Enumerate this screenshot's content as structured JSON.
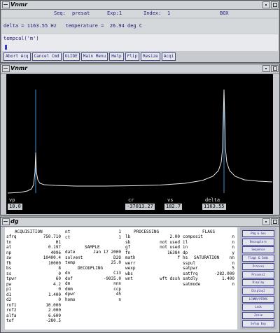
{
  "cmd_window": {
    "title": "Vnmr",
    "seq_label": "Seq:",
    "seq_value": "presat",
    "exp_label": "Exp:1",
    "index_label": "Index:",
    "index_value": "1",
    "box_label": "BOX",
    "status_line": "delta = 1163.55 Hz   temperature =  26.94 deg C",
    "command_line": "tempcal('m')",
    "buttons": [
      "Abort Acq",
      "Cancel Cmd",
      "GLIDE",
      "Main Menu",
      "Help",
      "Flip",
      "Resize",
      "Acqi"
    ]
  },
  "spectrum_window": {
    "title": "Vnmr",
    "readouts": [
      {
        "label": "vp",
        "value": "10.0"
      },
      {
        "label": "cr",
        "value": "-37013.27"
      },
      {
        "label": "vs",
        "value": "182.7"
      },
      {
        "label": "delta",
        "value": "1163.55"
      }
    ],
    "trace_color": "#e8e8e8",
    "cursor_color": "#3b8fd8"
  },
  "dg_window": {
    "title": "dg",
    "col1": {
      "header": "ACQUISITION",
      "rows": [
        [
          "sfrq",
          "750.710"
        ],
        [
          "tn",
          "H1"
        ],
        [
          "at",
          "0.197"
        ],
        [
          "np",
          "4096"
        ],
        [
          "sw",
          "10400.4"
        ],
        [
          "fb",
          "10000"
        ],
        [
          "bs",
          "8"
        ],
        [
          "ss",
          "0"
        ],
        [
          "tpwr",
          "60"
        ],
        [
          "pw",
          "4.2"
        ],
        [
          "p1",
          "0"
        ],
        [
          "d1",
          "1.400"
        ],
        [
          "d2",
          "0"
        ],
        [
          "rof1",
          "10.000"
        ],
        [
          "rof2",
          "2.000"
        ],
        [
          "alfa",
          "6.600"
        ],
        [
          "tof",
          "-280.5"
        ]
      ]
    },
    "col2": {
      "rows": [
        [
          "nt",
          "1"
        ],
        [
          "ct",
          "1"
        ]
      ],
      "sample_header": "SAMPLE",
      "sample_rows": [
        [
          "date",
          "Jan 17 2000"
        ],
        [
          "solvent",
          "D2O"
        ],
        [
          "temp",
          "25.0"
        ]
      ],
      "decoupling_header": "DECOUPLING",
      "decoupling_rows": [
        [
          "dn",
          "C13"
        ],
        [
          "dof",
          "-9035.0"
        ],
        [
          "dm",
          "nnn"
        ],
        [
          "dmm",
          "ccp"
        ],
        [
          "dpwr",
          "45"
        ],
        [
          "homo",
          "n"
        ]
      ]
    },
    "col3": {
      "header": "PROCESSING",
      "rows": [
        [
          "lb",
          "2.00"
        ],
        [
          "sb",
          "not used"
        ],
        [
          "gf",
          "not used"
        ],
        [
          "fn",
          "16384"
        ],
        [
          "math",
          "f"
        ]
      ],
      "rows2": [
        [
          "werr",
          ""
        ],
        [
          "wexp",
          ""
        ],
        [
          "wbs",
          ""
        ],
        [
          "wnt",
          "wft dssh"
        ]
      ]
    },
    "col4": {
      "header": "FLAGS",
      "rows": [
        [
          "composit",
          "n"
        ],
        [
          "il",
          "n"
        ],
        [
          "in",
          "n"
        ],
        [
          "dp",
          "y"
        ],
        [
          "hs",
          "nn"
        ]
      ],
      "sat_header": "SATURATION",
      "sat_rows": [
        [
          "sspul",
          "n"
        ],
        [
          "satpwr",
          "5"
        ],
        [
          "satfrq",
          "-282.000"
        ],
        [
          "satdly",
          "1.400"
        ],
        [
          "satmode",
          "n"
        ]
      ]
    },
    "side_buttons": [
      "Pbg & Gex",
      "Decouplers",
      "Sequence",
      "Flags & Cmds",
      "Process",
      "Process2",
      "Display",
      "Display2",
      "LCNMR/PFRMS",
      "Lock",
      "Zshim",
      "Setup Exp"
    ]
  }
}
